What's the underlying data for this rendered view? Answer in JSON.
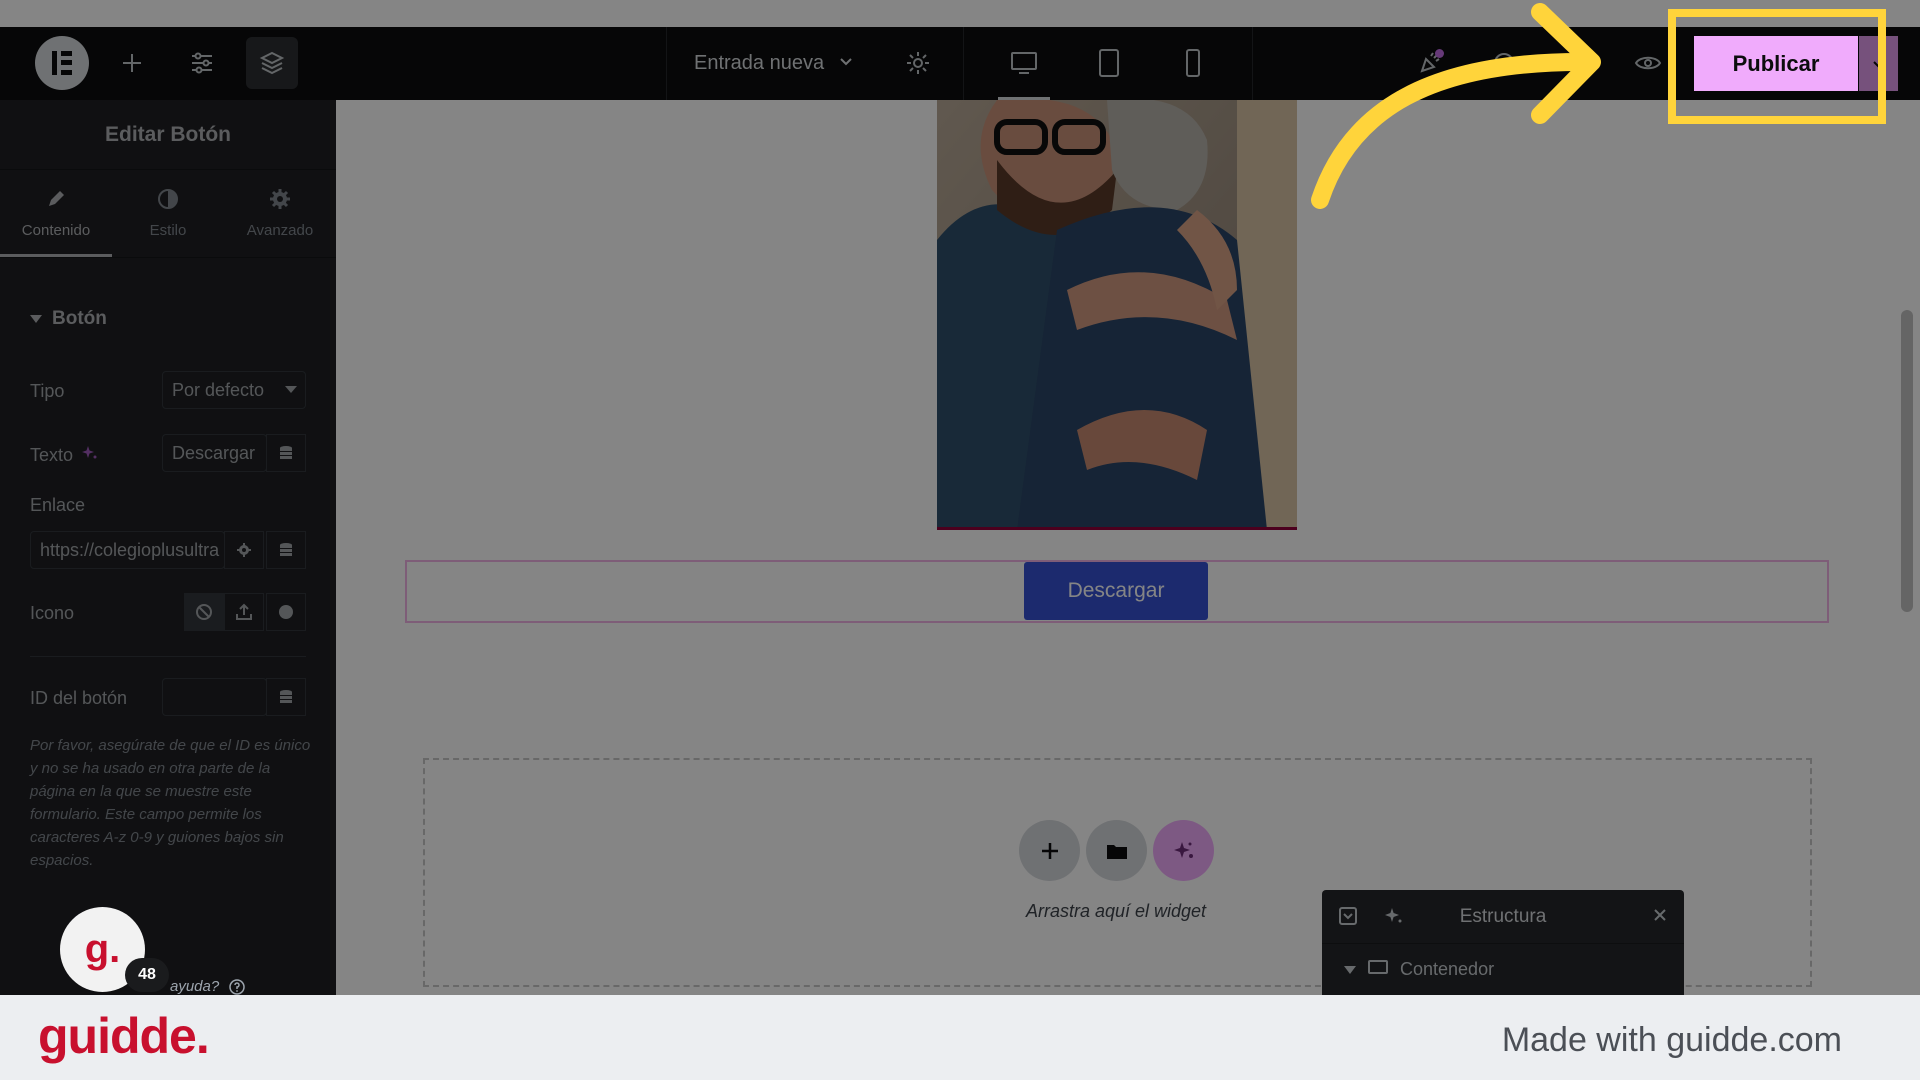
{
  "topbar": {
    "document_title": "Entrada nueva",
    "publish_label": "Publicar"
  },
  "panel": {
    "title": "Editar Botón",
    "tabs": [
      {
        "label": "Contenido",
        "icon": "pencil-icon",
        "active": true
      },
      {
        "label": "Estilo",
        "icon": "contrast-icon",
        "active": false
      },
      {
        "label": "Avanzado",
        "icon": "gear-icon",
        "active": false
      }
    ],
    "section_title": "Botón",
    "type_label": "Tipo",
    "type_value": "Por defecto",
    "text_label": "Texto",
    "text_value": "Descargar",
    "link_label": "Enlace",
    "link_value": "https://colegioplusultra",
    "icon_label": "Icono",
    "button_id_label": "ID del botón",
    "button_id_value": "",
    "help_text": "Por favor, asegúrate de que el ID es único y no se ha usado en otra parte de la página en la que se muestre este formulario. Este campo permite los caracteres A-z  0-9 y guiones bajos sin espacios."
  },
  "canvas": {
    "button_text": "Descargar",
    "dropzone_text": "Arrastra aquí el widget"
  },
  "structure": {
    "title": "Estructura",
    "row_label": "Contenedor"
  },
  "help": {
    "badge_letter": "g.",
    "count": "48",
    "link_text": "ayuda?"
  },
  "footer": {
    "logo": "guidde.",
    "made_with": "Made with guidde.com"
  },
  "colors": {
    "publish": "#f0abfc",
    "highlight": "#ffd43b",
    "button": "#3651d4",
    "brand": "#c8102e"
  }
}
